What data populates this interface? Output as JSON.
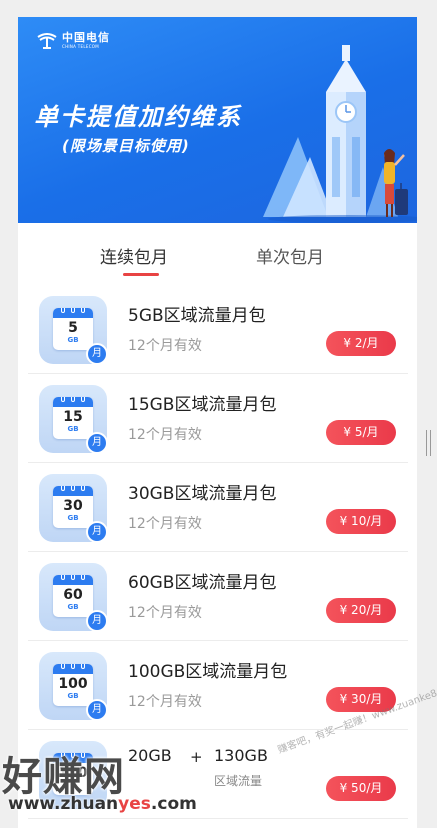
{
  "banner": {
    "logo_cn": "中国电信",
    "logo_en": "CHINA TELECOM",
    "headline": "单卡提值加约维系",
    "subline": "(限场景目标使用)"
  },
  "tabs": [
    {
      "label": "连续包月",
      "active": true
    },
    {
      "label": "单次包月",
      "active": false
    }
  ],
  "packages": [
    {
      "icon_num": "5",
      "icon_unit": "GB",
      "badge": "月",
      "title": "5GB区域流量月包",
      "validity": "12个月有效",
      "price": "¥ 2/月"
    },
    {
      "icon_num": "15",
      "icon_unit": "GB",
      "badge": "月",
      "title": "15GB区域流量月包",
      "validity": "12个月有效",
      "price": "¥ 5/月"
    },
    {
      "icon_num": "30",
      "icon_unit": "GB",
      "badge": "月",
      "title": "30GB区域流量月包",
      "validity": "12个月有效",
      "price": "¥ 10/月"
    },
    {
      "icon_num": "60",
      "icon_unit": "GB",
      "badge": "月",
      "title": "60GB区域流量月包",
      "validity": "12个月有效",
      "price": "¥ 20/月"
    },
    {
      "icon_num": "100",
      "icon_unit": "GB",
      "badge": "月",
      "title": "100GB区域流量月包",
      "validity": "12个月有效",
      "price": "¥ 30/月"
    }
  ],
  "combo": {
    "icon_num": "150",
    "part": "20GB",
    "plus": "+",
    "amount": "130GB",
    "caption": "区域流量",
    "price": "¥ 50/月"
  },
  "watermark": {
    "title": "好赚网",
    "url_pre": "www.zhuan",
    "url_accent": "yes",
    "url_post": ".com",
    "diag": "赚客吧，有奖一起赚！www.zuanke8.com"
  },
  "colors": {
    "banner": "#1a6fe8",
    "accent_red": "#ea3a4a",
    "icon_blue": "#2d7cf0"
  }
}
